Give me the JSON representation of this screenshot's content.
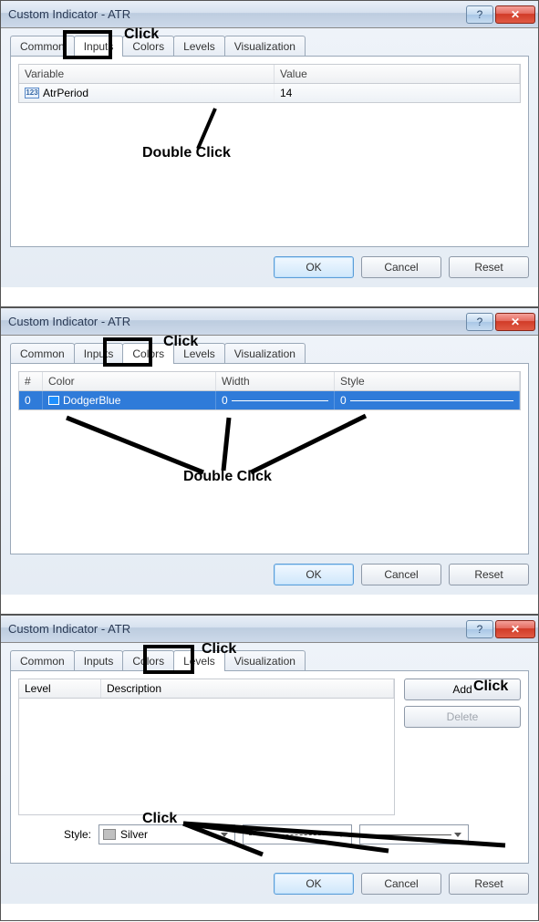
{
  "windowTitle": "Custom Indicator - ATR",
  "helpGlyph": "?",
  "closeGlyph": "✕",
  "tabs": {
    "common": "Common",
    "inputs": "Inputs",
    "colors": "Colors",
    "levels": "Levels",
    "visualization": "Visualization"
  },
  "buttons": {
    "ok": "OK",
    "cancel": "Cancel",
    "reset": "Reset",
    "add": "Add",
    "delete": "Delete"
  },
  "annotations": {
    "click": "Click",
    "doubleClick": "Double Click"
  },
  "inputsPanel": {
    "headers": {
      "variable": "Variable",
      "value": "Value"
    },
    "rows": [
      {
        "iconText": "123",
        "variable": "AtrPeriod",
        "value": "14"
      }
    ]
  },
  "colorsPanel": {
    "headers": {
      "num": "#",
      "color": "Color",
      "width": "Width",
      "style": "Style"
    },
    "rows": [
      {
        "num": "0",
        "color": "DodgerBlue",
        "width": "0",
        "style": "0"
      }
    ]
  },
  "levelsPanel": {
    "headers": {
      "level": "Level",
      "description": "Description"
    },
    "styleLabel": "Style:",
    "styleColor": "Silver"
  }
}
